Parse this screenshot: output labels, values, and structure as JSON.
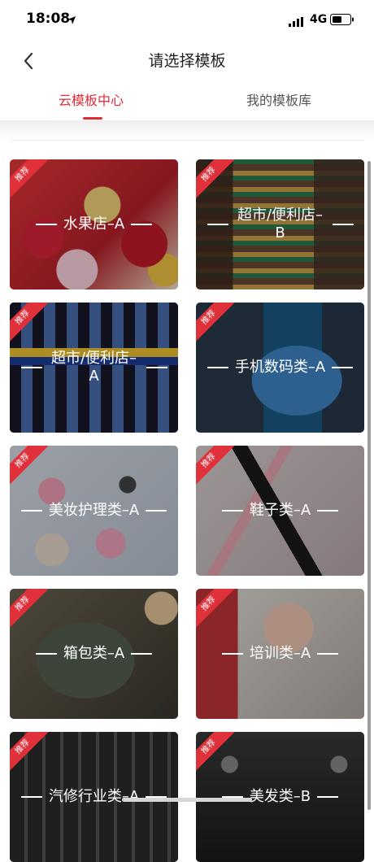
{
  "status_bar": {
    "time": "18:08",
    "network": "4G"
  },
  "nav": {
    "title": "请选择模板"
  },
  "tabs": [
    {
      "label": "云模板中心",
      "active": true
    },
    {
      "label": "我的模板库",
      "active": false
    }
  ],
  "accent_color": "#e02b37",
  "badge_text": "推荐",
  "templates": [
    {
      "label": "水果店–A"
    },
    {
      "label": "超市/便利店–B"
    },
    {
      "label": "超市/便利店–A"
    },
    {
      "label": "手机数码类–A"
    },
    {
      "label": "美妆护理类–A"
    },
    {
      "label": "鞋子类–A"
    },
    {
      "label": "箱包类–A"
    },
    {
      "label": "培训类–A"
    },
    {
      "label": "汽修行业类–A"
    },
    {
      "label": "美发类–B"
    }
  ],
  "icons": {
    "location": "location-arrow-icon",
    "signal": "cellular-signal-icon",
    "battery": "battery-icon",
    "back": "chevron-left-icon"
  }
}
